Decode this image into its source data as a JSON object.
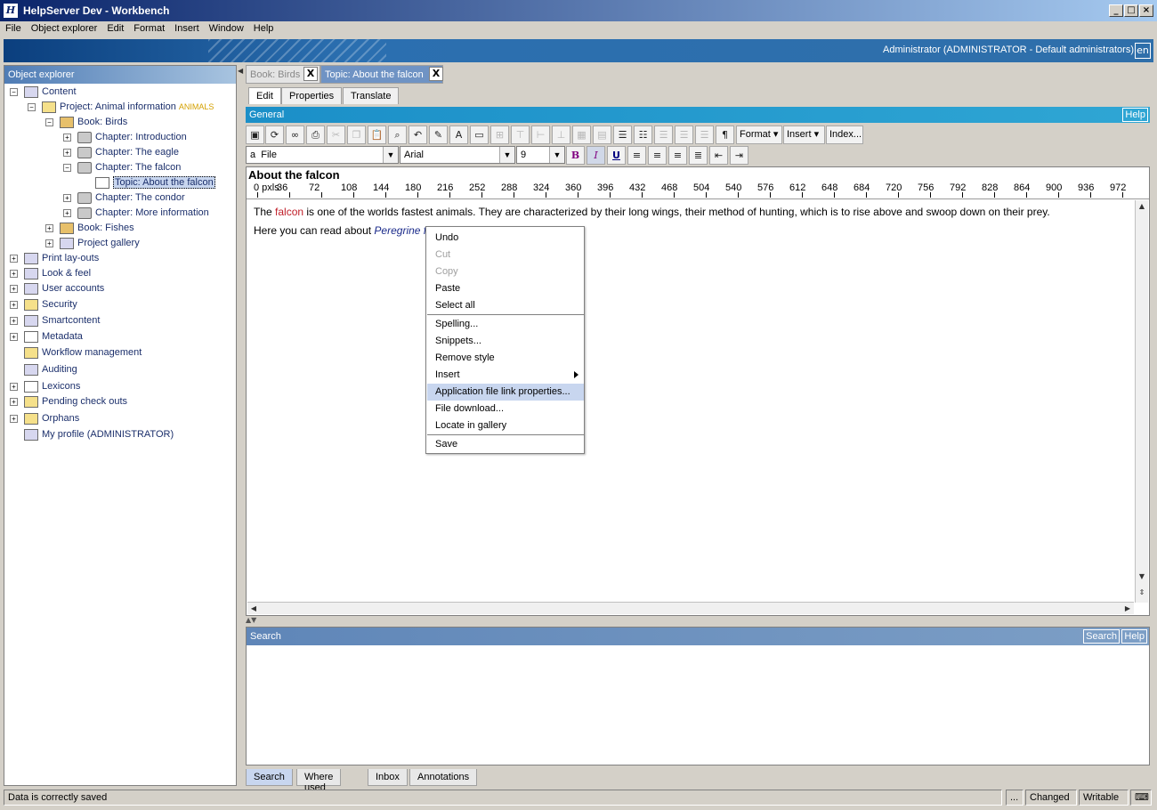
{
  "window": {
    "title": "HelpServer Dev - Workbench"
  },
  "menu": [
    "File",
    "Object explorer",
    "Edit",
    "Format",
    "Insert",
    "Window",
    "Help"
  ],
  "banner": {
    "user": "Administrator (ADMINISTRATOR - Default administrators)",
    "lang": "en"
  },
  "explorer": {
    "title": "Object explorer",
    "nodes": [
      {
        "label": "Content"
      },
      {
        "label": "Project: Animal information",
        "tag": "ANIMALS"
      },
      {
        "label": "Book: Birds"
      },
      {
        "label": "Chapter: Introduction"
      },
      {
        "label": "Chapter: The eagle"
      },
      {
        "label": "Chapter: The falcon"
      },
      {
        "label": "Topic: About the falcon"
      },
      {
        "label": "Chapter: The condor"
      },
      {
        "label": "Chapter: More information"
      },
      {
        "label": "Book: Fishes"
      },
      {
        "label": "Project gallery"
      },
      {
        "label": "Print lay-outs"
      },
      {
        "label": "Look & feel"
      },
      {
        "label": "User accounts"
      },
      {
        "label": "Security"
      },
      {
        "label": "Smartcontent"
      },
      {
        "label": "Metadata"
      },
      {
        "label": "Workflow management"
      },
      {
        "label": "Auditing"
      },
      {
        "label": "Lexicons"
      },
      {
        "label": "Pending check outs"
      },
      {
        "label": "Orphans"
      },
      {
        "label": "My profile (ADMINISTRATOR)"
      }
    ]
  },
  "doctabs": [
    {
      "label": "Book: Birds",
      "close": "X"
    },
    {
      "label": "Topic: About the falcon",
      "close": "X"
    }
  ],
  "subtabs": [
    "Edit",
    "Properties",
    "Translate"
  ],
  "general": {
    "title": "General",
    "help": "Help"
  },
  "toolbar": {
    "format": "Format",
    "insert": "Insert",
    "index": "Index..."
  },
  "format_bar": {
    "style": "File",
    "font": "Arial",
    "size": "9",
    "style_icon": "a"
  },
  "editor": {
    "doc_title": "About the falcon",
    "ruler": [
      "0 pxls",
      "36",
      "72",
      "108",
      "144",
      "180",
      "216",
      "252",
      "288",
      "324",
      "360",
      "396",
      "432",
      "468",
      "504",
      "540",
      "576",
      "612",
      "648",
      "684",
      "720",
      "756",
      "792",
      "828",
      "864",
      "900",
      "936",
      "972"
    ],
    "line1_pre": "The ",
    "line1_word": "falcon",
    "line1_post": " is one of the worlds fastest animals. They are characterized by their long wings, their method of hunting, which is to rise above and swoop down on their prey.",
    "line2_pre": "Here you can read about ",
    "line2_link": "Peregrine falcon.pdf"
  },
  "context_menu": [
    {
      "label": "Undo"
    },
    {
      "label": "Cut",
      "disabled": true
    },
    {
      "label": "Copy",
      "disabled": true
    },
    {
      "label": "Paste"
    },
    {
      "label": "Select all"
    },
    {
      "label": "Spelling..."
    },
    {
      "label": "Snippets..."
    },
    {
      "label": "Remove style"
    },
    {
      "label": "Insert"
    },
    {
      "label": "Application file link properties..."
    },
    {
      "label": "File download..."
    },
    {
      "label": "Locate in gallery"
    },
    {
      "label": "Save"
    }
  ],
  "search_panel": {
    "title": "Search",
    "search_btn": "Search",
    "help_btn": "Help"
  },
  "bottom_tabs": [
    "Search",
    "Where used",
    "Inbox",
    "Annotations"
  ],
  "status": {
    "message": "Data is correctly saved",
    "dots": "...",
    "changed": "Changed",
    "writable": "Writable"
  },
  "colors": {
    "accent": "#1b8fc8",
    "title_bar": "#0a246a",
    "selection": "#c8d6ef",
    "highlight_word": "#c0202a"
  }
}
